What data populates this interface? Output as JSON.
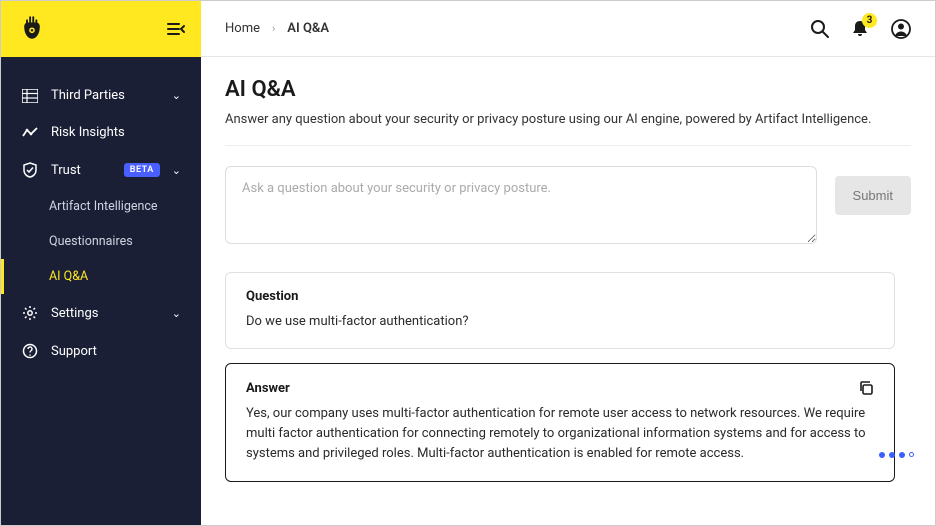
{
  "brand": {
    "accent": "#ffe81f",
    "sidebar_bg": "#1a1f36"
  },
  "sidebar": {
    "items": [
      {
        "icon": "list-icon",
        "label": "Third Parties",
        "expandable": true
      },
      {
        "icon": "chart-icon",
        "label": "Risk Insights",
        "expandable": false
      },
      {
        "icon": "shield-icon",
        "label": "Trust",
        "badge": "BETA",
        "expandable": true,
        "expanded": true,
        "children": [
          {
            "label": "Artifact Intelligence"
          },
          {
            "label": "Questionnaires"
          },
          {
            "label": "AI Q&A",
            "active": true
          }
        ]
      },
      {
        "icon": "gear-icon",
        "label": "Settings",
        "expandable": true
      },
      {
        "icon": "help-icon",
        "label": "Support",
        "expandable": false
      }
    ]
  },
  "breadcrumb": {
    "home": "Home",
    "current": "AI Q&A"
  },
  "topbar": {
    "notification_count": "3"
  },
  "page": {
    "title": "AI Q&A",
    "description": "Answer any question about your security or privacy posture using our AI engine, powered by Artifact Intelligence.",
    "textarea_placeholder": "Ask a question about your security or privacy posture.",
    "submit_label": "Submit"
  },
  "qa": {
    "question_label": "Question",
    "question_text": "Do we use multi-factor authentication?",
    "answer_label": "Answer",
    "answer_text": "Yes, our company uses multi-factor authentication for remote user access to network resources. We require multi factor authentication for connecting remotely to organizational information systems and for access to systems and privileged roles. Multi-factor authentication is enabled for remote access."
  }
}
